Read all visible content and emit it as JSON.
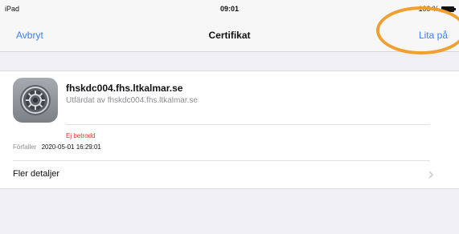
{
  "status_bar": {
    "device": "iPad",
    "time": "09:01",
    "battery": "100 %"
  },
  "nav": {
    "cancel_label": "Avbryt",
    "title": "Certifikat",
    "trust_label": "Lita på"
  },
  "certificate": {
    "name": "fhskdc004.fhs.ltkalmar.se",
    "issuer_line": "Utfärdat av fhskdc004.fhs.ltkalmar.se",
    "trust_status": "Ej betrodd",
    "expiry_label": "Förfaller",
    "expiry_value": "2020-05-01 16:29:01",
    "details_label": "Fler detaljer"
  },
  "colors": {
    "accent": "#3a82f7",
    "untrusted": "#e8332b",
    "highlight": "#f0a030"
  },
  "icons": {
    "certificate": "settings-gear-icon",
    "details": "chevron-right-icon",
    "battery": "battery-icon"
  }
}
